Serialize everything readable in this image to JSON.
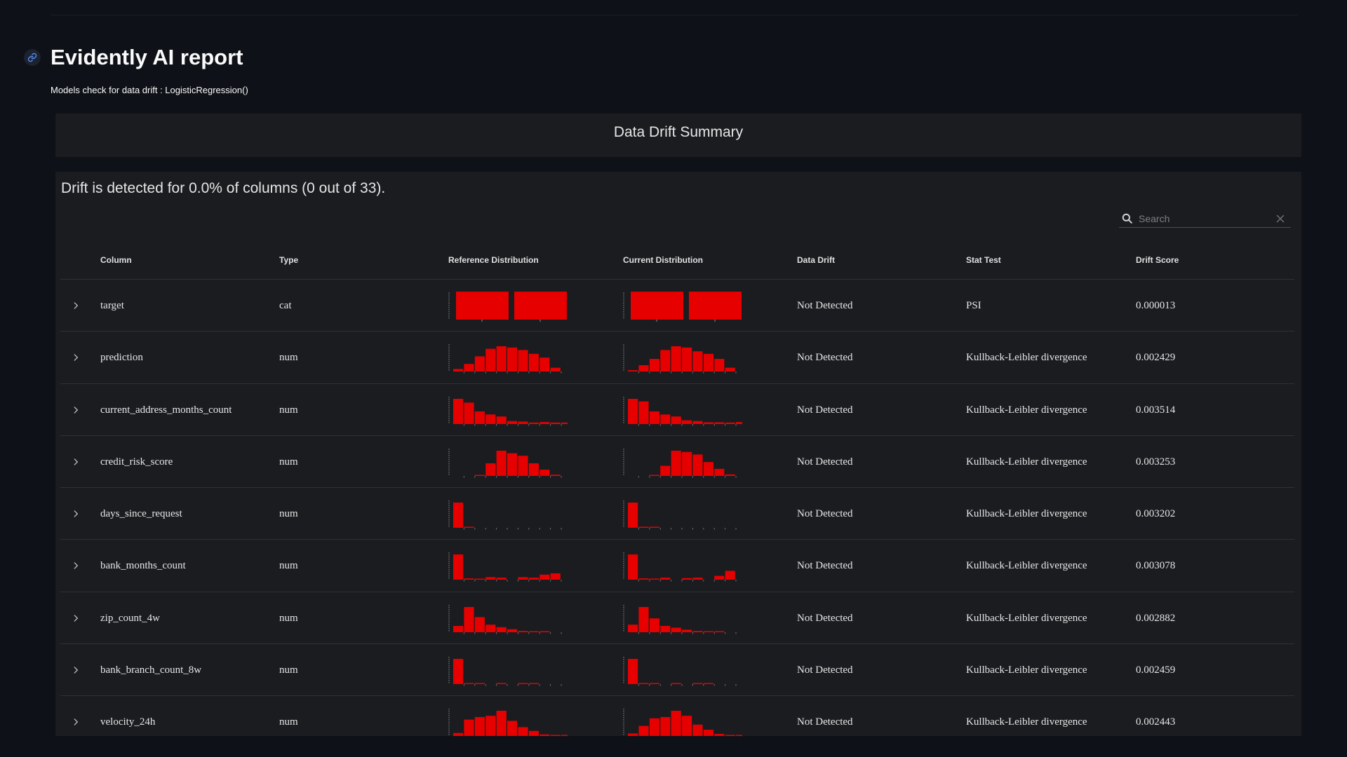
{
  "header": {
    "title": "Evidently AI report",
    "subtitle": "Models check for data drift : LogisticRegression()"
  },
  "summary": {
    "title": "Data Drift Summary",
    "drift_text": "Drift is detected for 0.0% of columns (0 out of 33)."
  },
  "search": {
    "placeholder": "Search"
  },
  "table": {
    "columns": [
      "Column",
      "Type",
      "Reference Distribution",
      "Current Distribution",
      "Data Drift",
      "Stat Test",
      "Drift Score"
    ],
    "rows": [
      {
        "column": "target",
        "type": "cat",
        "ref": [
          1,
          1
        ],
        "cur": [
          1,
          1
        ],
        "drift": "Not Detected",
        "test": "PSI",
        "score": "0.000013"
      },
      {
        "column": "prediction",
        "type": "num",
        "ref": [
          0.1,
          0.3,
          0.6,
          0.9,
          1.0,
          0.95,
          0.85,
          0.7,
          0.55,
          0.15,
          0,
          0
        ],
        "cur": [
          0.05,
          0.25,
          0.5,
          0.85,
          1.0,
          0.95,
          0.8,
          0.7,
          0.5,
          0.15,
          0,
          0
        ],
        "drift": "Not Detected",
        "test": "Kullback-Leibler divergence",
        "score": "0.002429"
      },
      {
        "column": "current_address_months_count",
        "type": "num",
        "ref": [
          1.0,
          0.85,
          0.5,
          0.38,
          0.3,
          0.12,
          0.1,
          0.06,
          0.08,
          0.06,
          0.06,
          0
        ],
        "cur": [
          1.0,
          0.9,
          0.5,
          0.38,
          0.3,
          0.15,
          0.12,
          0.07,
          0.07,
          0.06,
          0.08,
          0
        ],
        "drift": "Not Detected",
        "test": "Kullback-Leibler divergence",
        "score": "0.003514"
      },
      {
        "column": "credit_risk_score",
        "type": "num",
        "ref": [
          0,
          0,
          0.03,
          0.5,
          1.0,
          0.9,
          0.8,
          0.5,
          0.25,
          0.05,
          0,
          0
        ],
        "cur": [
          0,
          0,
          0.03,
          0.4,
          1.0,
          0.95,
          0.85,
          0.55,
          0.28,
          0.06,
          0,
          0
        ],
        "drift": "Not Detected",
        "test": "Kullback-Leibler divergence",
        "score": "0.003253"
      },
      {
        "column": "days_since_request",
        "type": "num",
        "ref": [
          1.0,
          0.02,
          0,
          0,
          0,
          0,
          0,
          0,
          0,
          0,
          0,
          0
        ],
        "cur": [
          1.0,
          0.03,
          0.02,
          0,
          0,
          0,
          0,
          0,
          0,
          0,
          0,
          0
        ],
        "drift": "Not Detected",
        "test": "Kullback-Leibler divergence",
        "score": "0.003202"
      },
      {
        "column": "bank_months_count",
        "type": "num",
        "ref": [
          1.0,
          0.05,
          0.02,
          0.1,
          0.08,
          0,
          0.1,
          0.08,
          0.2,
          0.25,
          0,
          0
        ],
        "cur": [
          1.0,
          0.05,
          0.03,
          0.08,
          0,
          0.06,
          0.08,
          0,
          0.15,
          0.35,
          0,
          0
        ],
        "drift": "Not Detected",
        "test": "Kullback-Leibler divergence",
        "score": "0.003078"
      },
      {
        "column": "zip_count_4w",
        "type": "num",
        "ref": [
          0.25,
          1.0,
          0.6,
          0.3,
          0.2,
          0.12,
          0.05,
          0.03,
          0.02,
          0,
          0,
          0
        ],
        "cur": [
          0.3,
          1.0,
          0.55,
          0.25,
          0.18,
          0.1,
          0.05,
          0.03,
          0.02,
          0,
          0,
          0
        ],
        "drift": "Not Detected",
        "test": "Kullback-Leibler divergence",
        "score": "0.002882"
      },
      {
        "column": "bank_branch_count_8w",
        "type": "num",
        "ref": [
          1.0,
          0.02,
          0.02,
          0,
          0.02,
          0,
          0.02,
          0.02,
          0,
          0,
          0,
          0
        ],
        "cur": [
          1.0,
          0.03,
          0.02,
          0,
          0.02,
          0,
          0.02,
          0.02,
          0,
          0,
          0,
          0
        ],
        "drift": "Not Detected",
        "test": "Kullback-Leibler divergence",
        "score": "0.002459"
      },
      {
        "column": "velocity_24h",
        "type": "num",
        "ref": [
          0.12,
          0.65,
          0.75,
          0.8,
          1.0,
          0.6,
          0.35,
          0.2,
          0.06,
          0.03,
          0.02,
          0
        ],
        "cur": [
          0.1,
          0.4,
          0.7,
          0.75,
          1.0,
          0.8,
          0.45,
          0.25,
          0.08,
          0.03,
          0.02,
          0
        ],
        "drift": "Not Detected",
        "test": "Kullback-Leibler divergence",
        "score": "0.002443"
      }
    ]
  },
  "colors": {
    "accent": "#e60000",
    "background": "#0e1117",
    "panel": "#1b1c20"
  }
}
